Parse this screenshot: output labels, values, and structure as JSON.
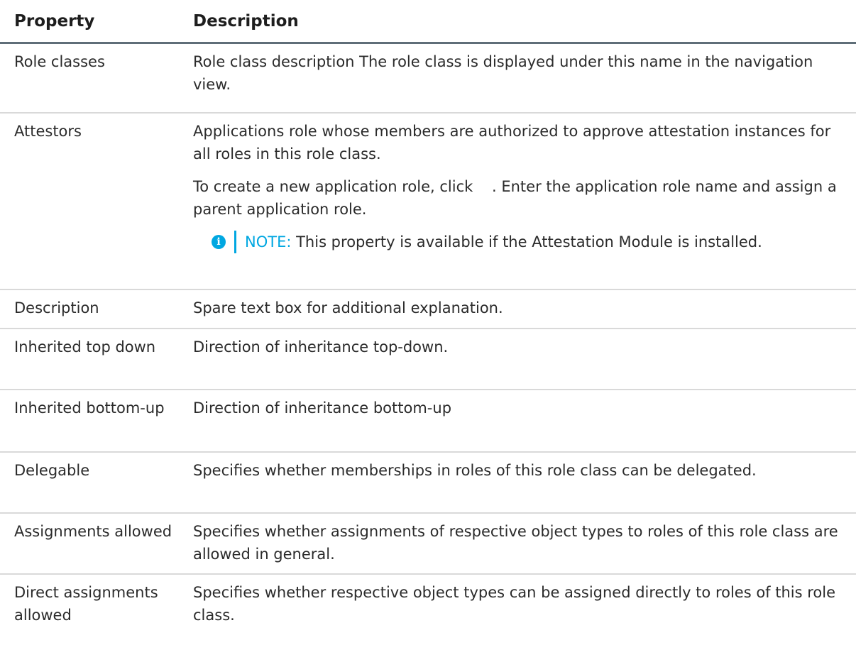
{
  "table": {
    "header": {
      "property": "Property",
      "description": "Description"
    },
    "rows": [
      {
        "property": "Role classes",
        "description": "Role class description The role class is displayed under this name in the navigation view."
      },
      {
        "property": "Attestors",
        "description": "Applications role whose members are authorized to approve attestation instances for all roles in this role class.",
        "description2": "To create a new application role, click    . Enter the application role name and assign a parent application role.",
        "note_label": "NOTE:",
        "note_text": " This property is available if the Attestation Module is installed."
      },
      {
        "property": "Description",
        "description": "Spare text box for additional explanation."
      },
      {
        "property": "Inherited top down",
        "description": "Direction of inheritance top-down."
      },
      {
        "property": "Inherited bottom-up",
        "description": "Direction of inheritance bottom-up"
      },
      {
        "property": "Delegable",
        "description": "Specifies whether memberships in roles of this role class can be delegated."
      },
      {
        "property": "Assignments allowed",
        "description": "Specifies whether assignments of respective object types to roles of this role class are allowed in general."
      },
      {
        "property": "Direct assignments allowed",
        "description": "Specifies whether respective object types can be assigned directly to roles of this role class."
      }
    ]
  },
  "icons": {
    "note": "info-icon"
  },
  "colors": {
    "accent": "#00a7e1",
    "header_rule": "#5f6e78",
    "row_rule": "#d9d9d9"
  }
}
